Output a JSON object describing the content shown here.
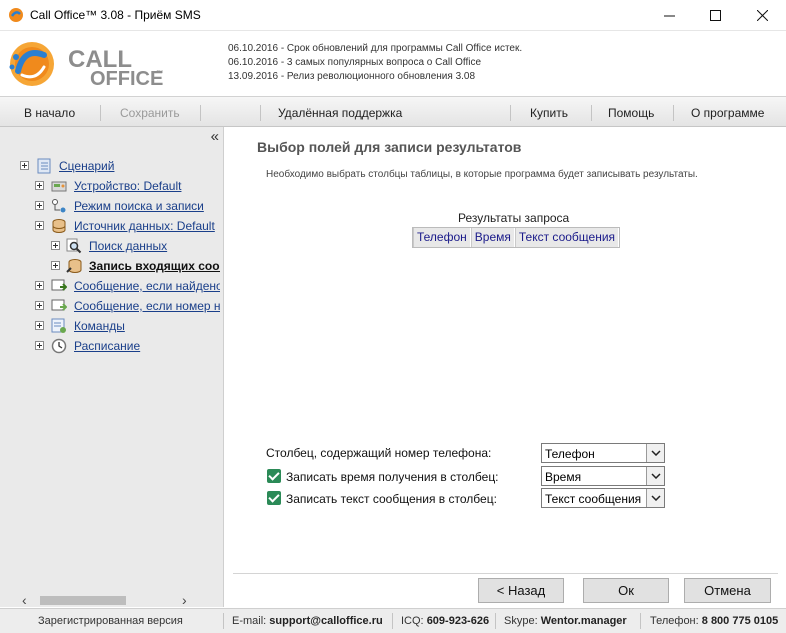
{
  "window": {
    "title": "Call Office™ 3.08 - Приём SMS",
    "minimize": "—",
    "maximize": "☐",
    "close": "✕"
  },
  "logo": {
    "line1": "CALL",
    "line2": "OFFICE",
    "tm": "™"
  },
  "news": [
    "06.10.2016 - Срок обновлений для программы Call Office истек.",
    "06.10.2016 - 3 самых популярных вопроса о Call Office",
    "13.09.2016 - Релиз революционного обновления 3.08"
  ],
  "toolbar": {
    "home": "В начало",
    "save": "Сохранить",
    "remote": "Удалённая поддержка",
    "buy": "Купить",
    "help": "Помощь",
    "about": "О программе"
  },
  "sidebar": {
    "collapse": "«",
    "tree": [
      {
        "label": "Сценарий",
        "icon": "scenario-icon"
      },
      {
        "label": "Устройство: Default",
        "icon": "device-icon"
      },
      {
        "label": "Режим поиска и записи",
        "icon": "search-mode-icon"
      },
      {
        "label": "Источник данных: Default",
        "icon": "database-icon"
      },
      {
        "label": "Поиск данных",
        "icon": "magnifier-icon"
      },
      {
        "label": "Запись входящих сообщений",
        "icon": "database-write-icon"
      },
      {
        "label": "Сообщение, если найдено",
        "icon": "message-found-icon"
      },
      {
        "label": "Сообщение, если номер не найден",
        "icon": "message-notfound-icon"
      },
      {
        "label": "Команды",
        "icon": "commands-icon"
      },
      {
        "label": "Расписание",
        "icon": "clock-icon"
      }
    ]
  },
  "main": {
    "title": "Выбор полей для записи результатов",
    "description": "Необходимо выбрать столбцы таблицы, в которые программа будет записывать результаты.",
    "table_caption": "Результаты запроса",
    "table_columns": [
      "Телефон",
      "Время",
      "Текст сообщения"
    ],
    "phone_label": "Столбец, содержащий номер телефона:",
    "phone_value": "Телефон",
    "time_label": "Записать время получения в столбец:",
    "time_value": "Время",
    "time_checked": true,
    "text_label": "Записать текст сообщения в столбец:",
    "text_value": "Текст сообщения",
    "text_checked": true,
    "back": "< Назад",
    "ok": "Ок",
    "cancel": "Отмена"
  },
  "status": {
    "registered": "Зарегистрированная версия",
    "email_label": "E-mail:",
    "email": "support@calloffice.ru",
    "icq_label": "ICQ:",
    "icq": "609-923-626",
    "skype_label": "Skype:",
    "skype": "Wentor.manager",
    "phone_label": "Телефон:",
    "phone": "8 800 775 0105"
  },
  "colors": {
    "accent_orange": "#f08a1c",
    "accent_blue": "#2a7fd0",
    "link": "#1a3f8a",
    "check": "#2b8a57"
  }
}
